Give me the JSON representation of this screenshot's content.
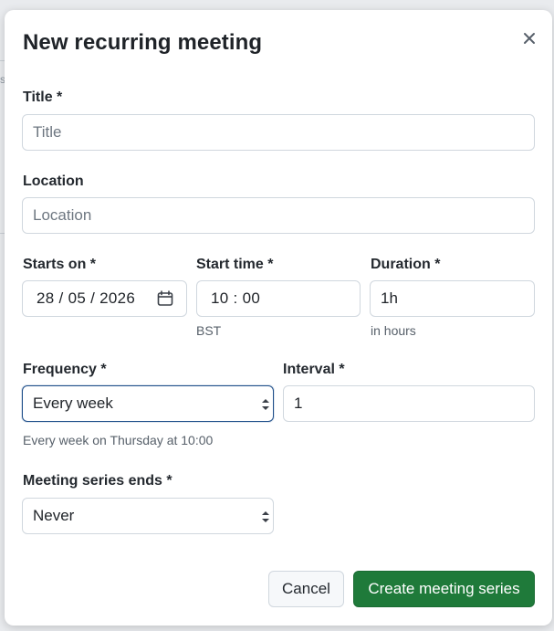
{
  "background": {
    "fragment_text": "s"
  },
  "dialog": {
    "title": "New recurring meeting",
    "close_icon": "close-icon"
  },
  "fields": {
    "title": {
      "label": "Title *",
      "placeholder": "Title",
      "value": ""
    },
    "location": {
      "label": "Location",
      "placeholder": "Location",
      "value": ""
    },
    "starts_on": {
      "label": "Starts on *",
      "value": "28 / 05 / 2026",
      "icon": "calendar-icon"
    },
    "start_time": {
      "label": "Start time *",
      "value": "10 : 00",
      "hint": "BST"
    },
    "duration": {
      "label": "Duration *",
      "value": "1h",
      "hint": "in hours"
    },
    "frequency": {
      "label": "Frequency *",
      "value": "Every week",
      "hint": "Every week on Thursday at 10:00"
    },
    "interval": {
      "label": "Interval *",
      "value": "1"
    },
    "series_ends": {
      "label": "Meeting series ends *",
      "value": "Never"
    }
  },
  "actions": {
    "cancel_label": "Cancel",
    "create_label": "Create meeting series"
  },
  "colors": {
    "primary": "#1f7a3a",
    "focus_border": "#1f4f8a",
    "border": "#d0d7de"
  }
}
